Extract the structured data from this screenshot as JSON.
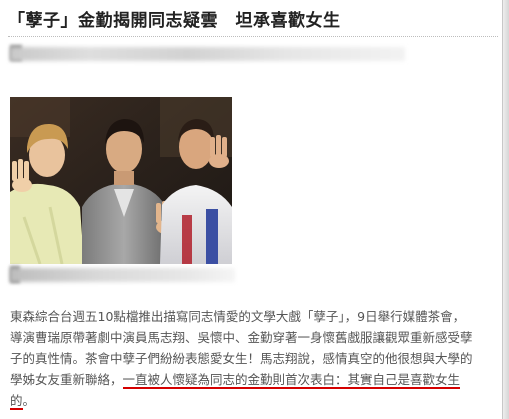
{
  "article": {
    "headline": "「孽子」金勤揭開同志疑雲　坦承喜歡女生",
    "body_lines": [
      "東森綜合台週五10點檔推出描寫同志情愛的文學大戲「孽子」，9日舉行媒體茶會，",
      "導演曹瑞原帶著劇中演員馬志翔、吳懷中、金勤穿著一身懷舊戲服讓觀眾重新感受孽",
      "子的真性情。茶會中孽子們紛紛表態愛女生！馬志翔說，感情真空的他很想與大學的"
    ],
    "line4_plain": "學姊女友重新聯絡，",
    "line4_underlined": "一直被人懷疑為同志的金勤則首次表白：其實自己是喜歡女生",
    "line5_underlined": "的",
    "line5_plain": "。"
  },
  "colors": {
    "underline": "#d40000",
    "body_text": "#555555",
    "headline": "#222222"
  }
}
